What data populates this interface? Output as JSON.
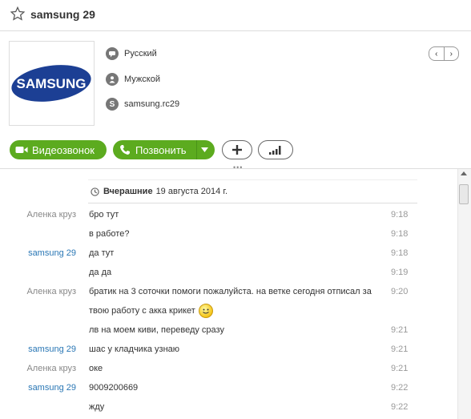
{
  "header": {
    "title": "samsung 29"
  },
  "profile": {
    "logo_text": "SAMSUNG",
    "language": "Русский",
    "gender": "Мужской",
    "skype_name": "samsung.rc29"
  },
  "actions": {
    "video_call": "Видеозвонок",
    "call": "Позвонить"
  },
  "chat": {
    "date_bold": "Вчерашние",
    "date_rest": "19 августа 2014 г.",
    "messages": [
      {
        "sender": "Аленка круз",
        "text": "бро тут",
        "time": "9:18"
      },
      {
        "sender": "",
        "text": "в работе?",
        "time": "9:18"
      },
      {
        "sender": "samsung 29",
        "text": "да тут",
        "time": "9:18"
      },
      {
        "sender": "",
        "text": "да да",
        "time": "9:19"
      },
      {
        "sender": "Аленка круз",
        "text": "братик на 3 соточки помоги пожалуйста. на ветке сегодня отписал за твою работу с акка крикет",
        "time": "9:20"
      },
      {
        "sender": "",
        "text": "лв на моем киви, переведу сразу",
        "time": "9:21"
      },
      {
        "sender": "samsung 29",
        "text": "шас у кладчика узнаю",
        "time": "9:21"
      },
      {
        "sender": "Аленка круз",
        "text": "оке",
        "time": "9:21"
      },
      {
        "sender": "samsung 29",
        "text": "9009200669",
        "time": "9:22"
      },
      {
        "sender": "",
        "text": "жду",
        "time": "9:22"
      }
    ]
  },
  "colors": {
    "green": "#5cab1f",
    "self_sender": "#2a77b5",
    "other_sender": "#888888"
  }
}
